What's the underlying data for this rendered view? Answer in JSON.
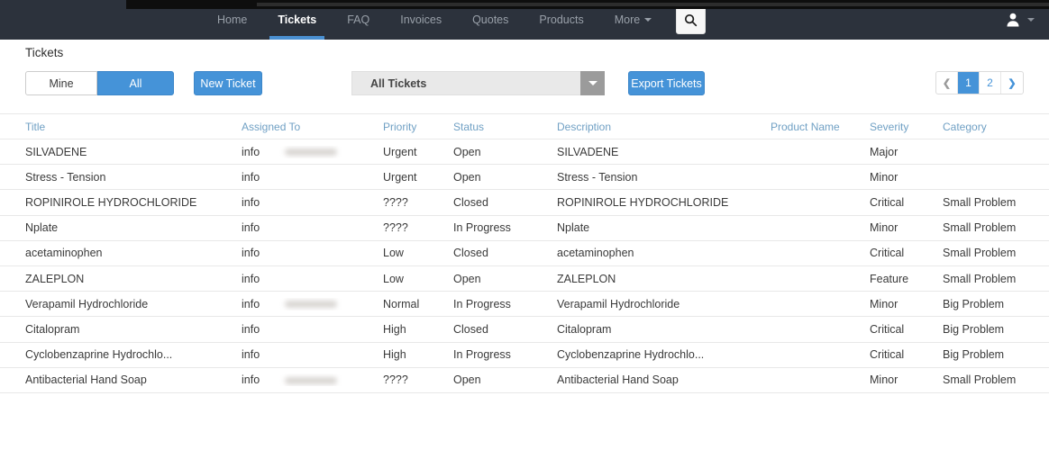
{
  "topbar": {
    "items": [
      {
        "label": "Home",
        "active": false,
        "caret": false
      },
      {
        "label": "Tickets",
        "active": true,
        "caret": false
      },
      {
        "label": "FAQ",
        "active": false,
        "caret": false
      },
      {
        "label": "Invoices",
        "active": false,
        "caret": false
      },
      {
        "label": "Quotes",
        "active": false,
        "caret": false
      },
      {
        "label": "Products",
        "active": false,
        "caret": false
      },
      {
        "label": "More",
        "active": false,
        "caret": true
      }
    ]
  },
  "page": {
    "title": "Tickets"
  },
  "toolbar": {
    "mine_label": "Mine",
    "all_label": "All",
    "new_ticket_label": "New Ticket",
    "filter_value": "All Tickets",
    "export_label": "Export Tickets",
    "pagination": {
      "prev": "❮",
      "pages": [
        "1",
        "2"
      ],
      "active_page": "1",
      "next": "❯"
    }
  },
  "colors": {
    "accent_blue": "#4593d8",
    "nav_background": "#2c323c",
    "nav_active_underline": "#4a90d2",
    "header_link_blue": "#70a0c4"
  },
  "table": {
    "columns": [
      "Title",
      "Assigned To",
      "Priority",
      "Status",
      "Description",
      "Product Name",
      "Severity",
      "Category"
    ],
    "rows": [
      {
        "title": "SILVADENE",
        "assigned": "info",
        "redacted": true,
        "priority": "Urgent",
        "status": "Open",
        "description": "SILVADENE",
        "product": "",
        "severity": "Major",
        "category": ""
      },
      {
        "title": "Stress - Tension",
        "assigned": "info",
        "redacted": false,
        "priority": "Urgent",
        "status": "Open",
        "description": "Stress - Tension",
        "product": "",
        "severity": "Minor",
        "category": ""
      },
      {
        "title": "ROPINIROLE HYDROCHLORIDE",
        "assigned": "info",
        "redacted": false,
        "priority": "????",
        "status": "Closed",
        "description": "ROPINIROLE HYDROCHLORIDE",
        "product": "",
        "severity": "Critical",
        "category": "Small Problem"
      },
      {
        "title": "Nplate",
        "assigned": "info",
        "redacted": false,
        "priority": "????",
        "status": "In Progress",
        "description": "Nplate",
        "product": "",
        "severity": "Minor",
        "category": "Small Problem"
      },
      {
        "title": "acetaminophen",
        "assigned": "info",
        "redacted": false,
        "priority": "Low",
        "status": "Closed",
        "description": "acetaminophen",
        "product": "",
        "severity": "Critical",
        "category": "Small Problem"
      },
      {
        "title": "ZALEPLON",
        "assigned": "info",
        "redacted": false,
        "priority": "Low",
        "status": "Open",
        "description": "ZALEPLON",
        "product": "",
        "severity": "Feature",
        "category": "Small Problem"
      },
      {
        "title": "Verapamil Hydrochloride",
        "assigned": "info",
        "redacted": true,
        "priority": "Normal",
        "status": "In Progress",
        "description": "Verapamil Hydrochloride",
        "product": "",
        "severity": "Minor",
        "category": "Big Problem"
      },
      {
        "title": "Citalopram",
        "assigned": "info",
        "redacted": false,
        "priority": "High",
        "status": "Closed",
        "description": "Citalopram",
        "product": "",
        "severity": "Critical",
        "category": "Big Problem"
      },
      {
        "title": "Cyclobenzaprine Hydrochlo...",
        "assigned": "info",
        "redacted": false,
        "priority": "High",
        "status": "In Progress",
        "description": "Cyclobenzaprine Hydrochlo...",
        "product": "",
        "severity": "Critical",
        "category": "Big Problem"
      },
      {
        "title": "Antibacterial Hand Soap",
        "assigned": "info",
        "redacted": true,
        "priority": "????",
        "status": "Open",
        "description": "Antibacterial Hand Soap",
        "product": "",
        "severity": "Minor",
        "category": "Small Problem"
      }
    ]
  }
}
